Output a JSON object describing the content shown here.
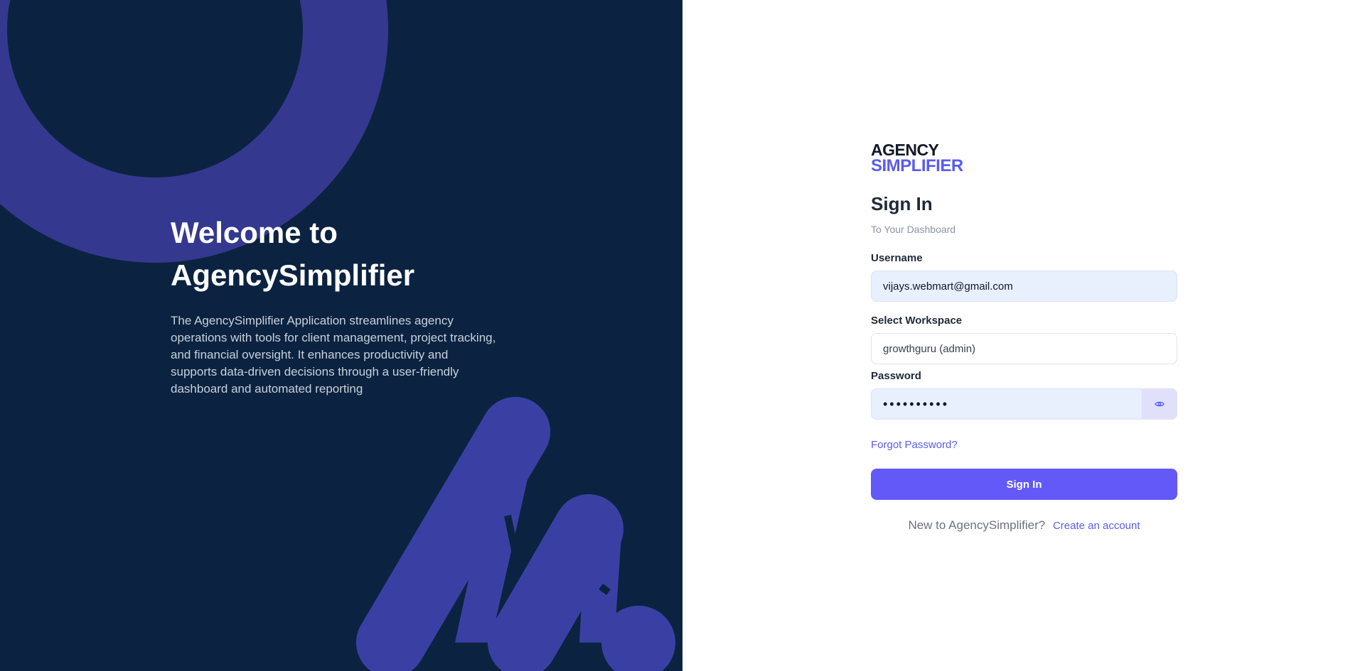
{
  "hero": {
    "title_line1": "Welcome to",
    "title_line2": "AgencySimplifier",
    "description": "The AgencySimplifier Application streamlines agency operations with tools for client management, project tracking, and financial oversight. It enhances productivity and supports data-driven decisions through a user-friendly dashboard and automated reporting"
  },
  "logo": {
    "line1": "AGENCY",
    "line2": "SIMPLIFIER"
  },
  "form": {
    "title": "Sign In",
    "subtitle": "To Your Dashboard",
    "username_label": "Username",
    "username_value": "vijays.webmart@gmail.com",
    "workspace_label": "Select Workspace",
    "workspace_value": "growthguru (admin)",
    "password_label": "Password",
    "password_mask": "••••••••••",
    "password_toggle_icon": "eye-icon",
    "forgot_label": "Forgot Password?",
    "signin_label": "Sign In",
    "new_prompt": "New to AgencySimplifier?",
    "create_label": "Create an account"
  },
  "colors": {
    "left_bg": "#0b2340",
    "shape": "#3a40a3",
    "accent": "#6359f8",
    "input_bg": "#e8effd"
  }
}
